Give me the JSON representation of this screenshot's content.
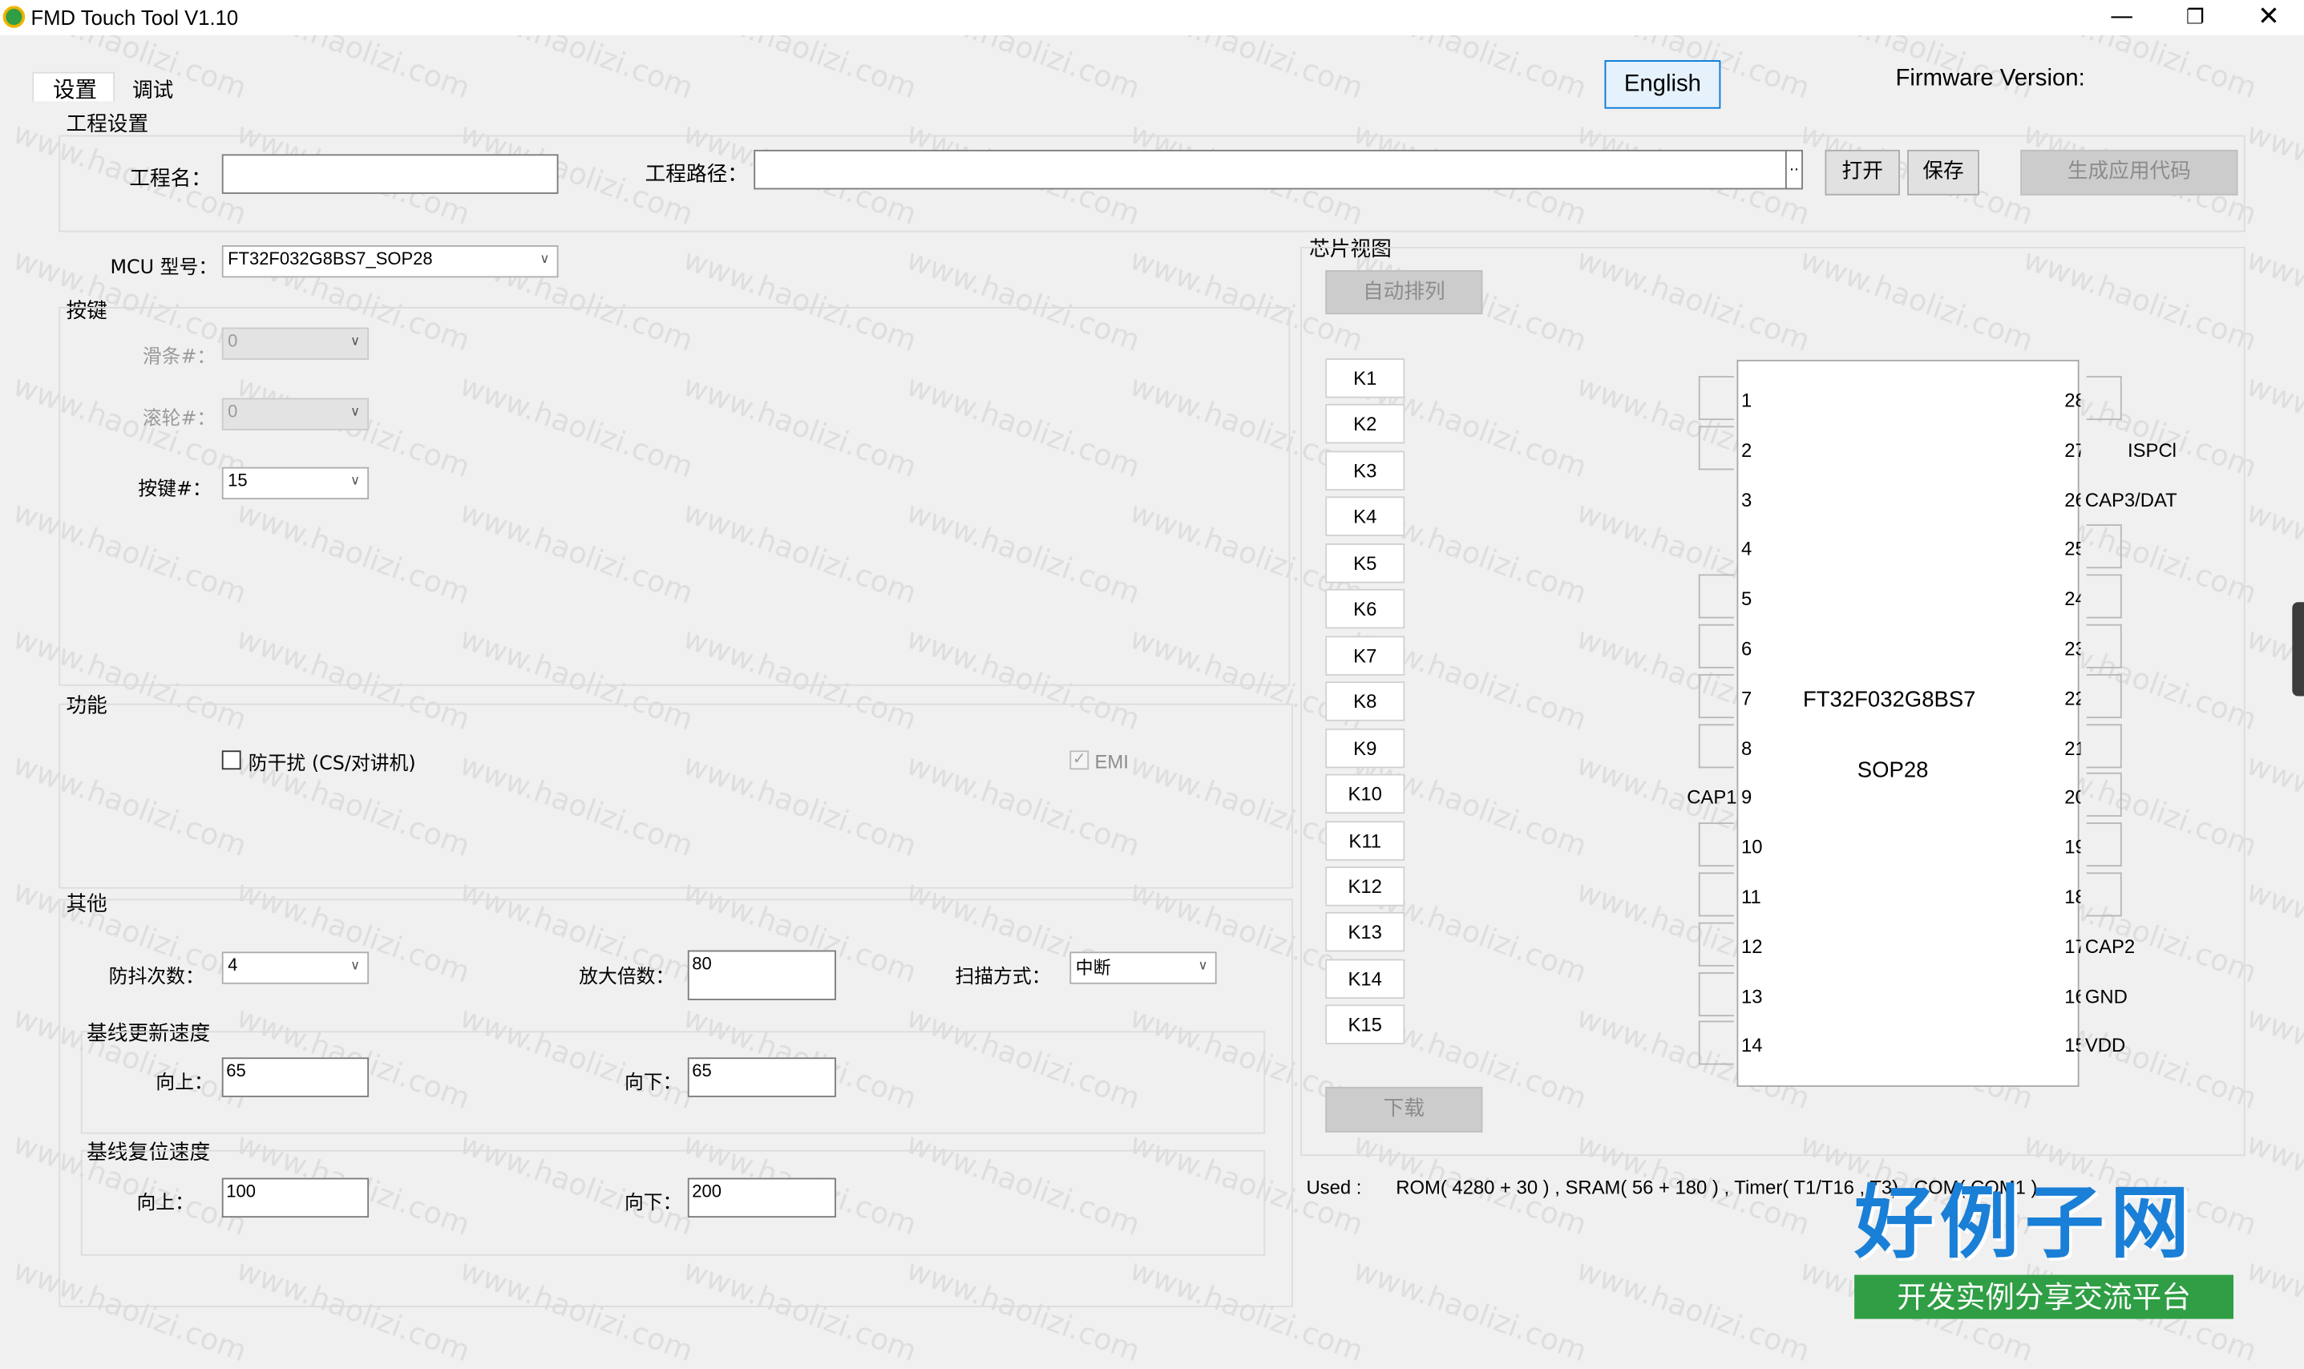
{
  "window": {
    "title": "FMD Touch Tool V1.10"
  },
  "tabs": [
    {
      "label": "设置"
    },
    {
      "label": "调试"
    }
  ],
  "lang_button": "English",
  "firmware_label": "Firmware Version:",
  "project": {
    "group": "工程设置",
    "name_label": "工程名：",
    "name_value": "",
    "path_label": "工程路径：",
    "path_value": "",
    "browse": "..",
    "open": "打开",
    "save": "保存",
    "generate": "生成应用代码"
  },
  "mcu": {
    "label": "MCU 型号：",
    "value": "FT32F032G8BS7_SOP28"
  },
  "keys": {
    "group": "按键",
    "slider_label": "滑条#：",
    "slider_value": "0",
    "wheel_label": "滚轮#：",
    "wheel_value": "0",
    "key_label": "按键#：",
    "key_value": "15"
  },
  "func": {
    "group": "功能",
    "anti_label": "防干扰 (CS/对讲机)",
    "emi_label": "EMI"
  },
  "other": {
    "group": "其他",
    "debounce_label": "防抖次数：",
    "debounce_value": "4",
    "gain_label": "放大倍数：",
    "gain_value": "80",
    "scan_label": "扫描方式：",
    "scan_value": "中断",
    "update_group": "基线更新速度",
    "update_up_label": "向上：",
    "update_up_value": "65",
    "update_down_label": "向下：",
    "update_down_value": "65",
    "reset_group": "基线复位速度",
    "reset_up_label": "向上：",
    "reset_up_value": "100",
    "reset_down_label": "向下：",
    "reset_down_value": "200"
  },
  "chip": {
    "group": "芯片视图",
    "auto_arrange": "自动排列",
    "download": "下载",
    "keys": [
      "K1",
      "K2",
      "K3",
      "K4",
      "K5",
      "K6",
      "K7",
      "K8",
      "K9",
      "K10",
      "K11",
      "K12",
      "K13",
      "K14",
      "K15"
    ],
    "name": "FT32F032G8BS7",
    "package": "SOP28",
    "left_pins": [
      "1",
      "2",
      "3",
      "4",
      "5",
      "6",
      "7",
      "8",
      "9",
      "10",
      "11",
      "12",
      "13",
      "14"
    ],
    "left_labels": [
      "",
      "",
      "",
      "",
      "",
      "",
      "",
      "",
      "CAP1",
      "",
      "",
      "",
      "",
      ""
    ],
    "right_pins": [
      "28",
      "27",
      "26",
      "25",
      "24",
      "23",
      "22",
      "21",
      "20",
      "19",
      "18",
      "17",
      "16",
      "15"
    ],
    "right_labels": [
      "",
      "ISPCl",
      "CAP3/DAT",
      "",
      "",
      "",
      "",
      "",
      "",
      "",
      "",
      "CAP2",
      "GND",
      "VDD"
    ]
  },
  "used": {
    "label": "Used :",
    "value": "ROM( 4280 + 30 ) , SRAM( 56 + 180 ) , Timer( T1/T16 , T3) , COM( COM1 )"
  },
  "watermark": {
    "text": "www.haolizi.com",
    "brand": "好例子网",
    "slogan": "开发实例分享交流平台"
  },
  "colors": {
    "accent": "#0078d7",
    "brand_blue": "#1a7fd6",
    "brand_green": "#2f9e44"
  }
}
